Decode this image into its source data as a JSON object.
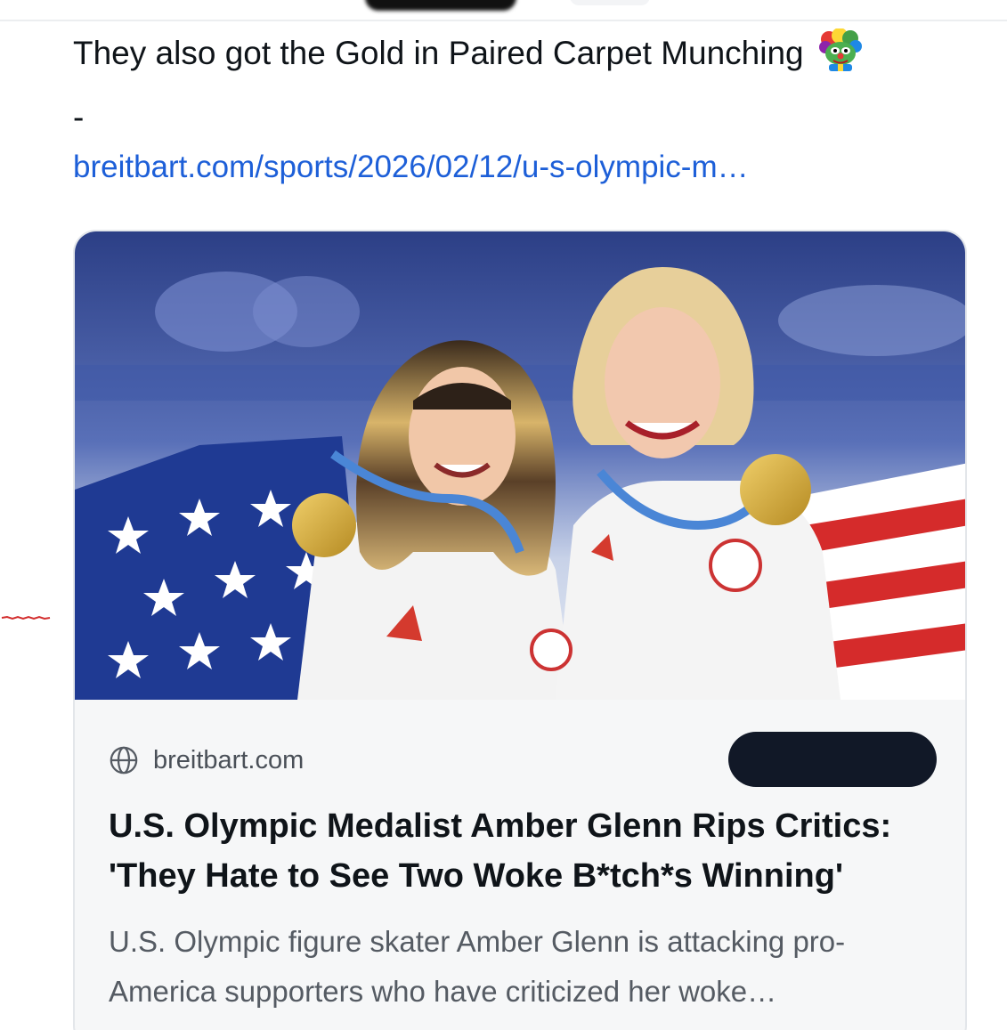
{
  "post": {
    "text": "They also got the Gold in Paired Carpet Munching",
    "emoji": "clown-pepe-emoji",
    "separator": "-",
    "link_text": "breitbart.com/sports/2026/02/12/u-s-olympic-m…"
  },
  "card": {
    "image": "photo-two-skaters-with-gold-medals-and-us-flag",
    "source_icon": "globe-icon",
    "source": "breitbart.com",
    "headline": "U.S. Olympic Medalist Amber Glenn Rips Critics: 'They Hate to See Two Woke B*tch*s Winning'",
    "description": "U.S. Olympic figure skater Amber Glenn is attacking pro-America supporters who have criticized her woke…"
  },
  "colors": {
    "link": "#1d5fd8",
    "text": "#0f1419",
    "muted": "#555b63",
    "card_bg": "#f6f7f8",
    "pill": "#111827"
  }
}
